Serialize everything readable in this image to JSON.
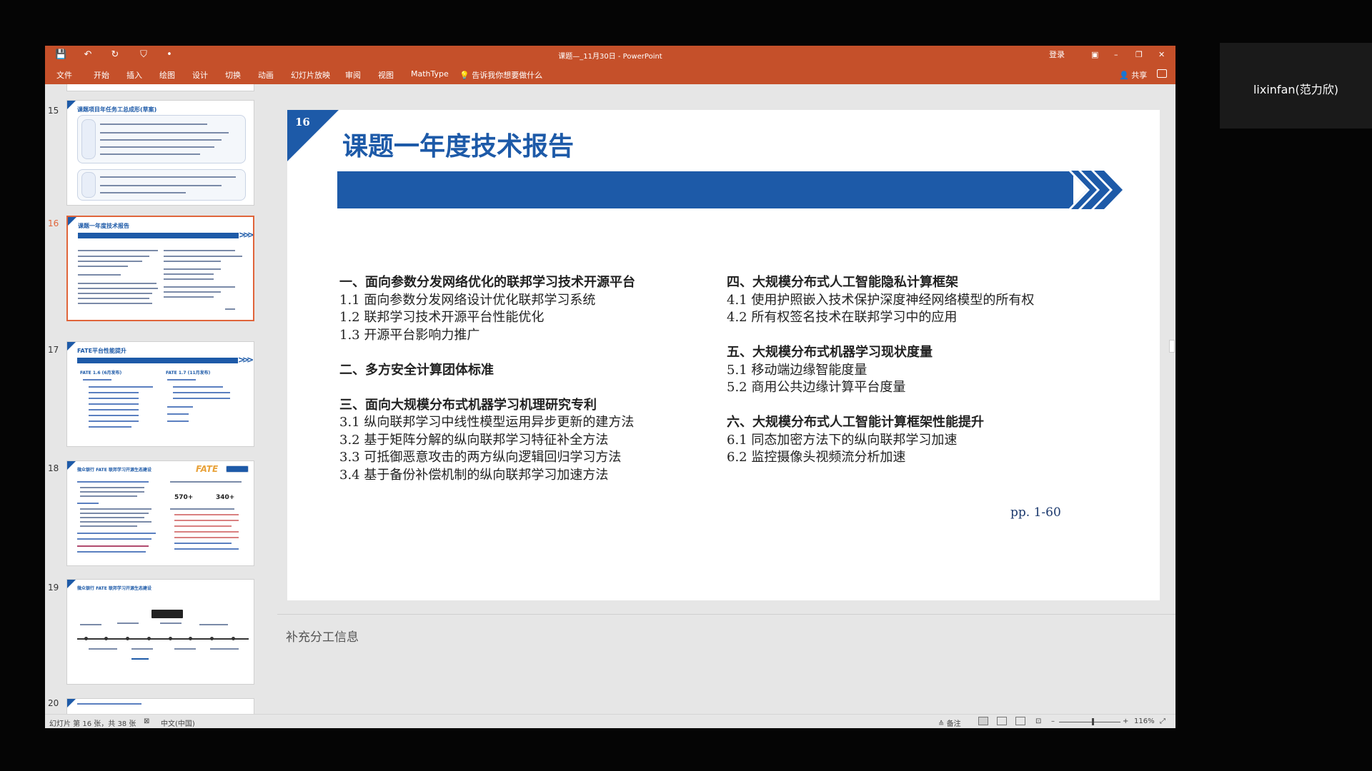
{
  "window": {
    "title": "课题—_11月30日 - PowerPoint",
    "signin": "登录",
    "quick_access": {
      "save": "💾",
      "undo": "↶",
      "redo": "↻",
      "more": "•"
    }
  },
  "ribbon": {
    "tabs": [
      "文件",
      "开始",
      "插入",
      "绘图",
      "设计",
      "切换",
      "动画",
      "幻灯片放映",
      "审阅",
      "视图",
      "MathType"
    ],
    "tell_me": "告诉我你想要做什么",
    "share": "共享"
  },
  "thumbnails": [
    {
      "number": "15",
      "title": "课题项目年任务工总成形(草案)"
    },
    {
      "number": "16",
      "title": "课题一年度技术报告"
    },
    {
      "number": "17",
      "title": "FATE平台性能提升",
      "sub_left": "FATE 1.6 (6月发布)",
      "sub_right": "FATE 1.7 (11月发布)"
    },
    {
      "number": "18",
      "title": "微众银行 FATE 联邦学习开源生态建设",
      "logo": "FATE",
      "stat1": "570+",
      "stat2": "340+"
    },
    {
      "number": "19",
      "title": "微众银行 FATE 联邦学习开源生态建设"
    },
    {
      "number": "20"
    }
  ],
  "slide": {
    "number": "16",
    "title": "课题一年度技术报告",
    "left_column": [
      {
        "text": "一、面向参数分发网络优化的联邦学习技术开源平台",
        "heading": true
      },
      {
        "text": "1.1 面向参数分发网络设计优化联邦学习系统",
        "heading": false
      },
      {
        "text": "1.2 联邦学习技术开源平台性能优化",
        "heading": false
      },
      {
        "text": "1.3 开源平台影响力推广",
        "heading": false
      },
      {
        "text": "",
        "heading": false
      },
      {
        "text": "二、多方安全计算团体标准",
        "heading": true
      },
      {
        "text": "",
        "heading": false
      },
      {
        "text": "三、面向大规模分布式机器学习机理研究专利",
        "heading": true
      },
      {
        "text": "3.1 纵向联邦学习中线性模型运用异步更新的建方法",
        "heading": false
      },
      {
        "text": "3.2 基于矩阵分解的纵向联邦学习特征补全方法",
        "heading": false
      },
      {
        "text": "3.3 可抵御恶意攻击的两方纵向逻辑回归学习方法",
        "heading": false
      },
      {
        "text": "3.4 基于备份补偿机制的纵向联邦学习加速方法",
        "heading": false
      }
    ],
    "right_column": [
      {
        "text": "四、大规模分布式人工智能隐私计算框架",
        "heading": true
      },
      {
        "text": "4.1 使用护照嵌入技术保护深度神经网络模型的所有权",
        "heading": false
      },
      {
        "text": "4.2 所有权签名技术在联邦学习中的应用",
        "heading": false
      },
      {
        "text": "",
        "heading": false
      },
      {
        "text": "五、大规模分布式机器学习现状度量",
        "heading": true
      },
      {
        "text": "5.1 移动端边缘智能度量",
        "heading": false
      },
      {
        "text": "5.2 商用公共边缘计算平台度量",
        "heading": false
      },
      {
        "text": "",
        "heading": false
      },
      {
        "text": "六、大规模分布式人工智能计算框架性能提升",
        "heading": true
      },
      {
        "text": "6.1 同态加密方法下的纵向联邦学习加速",
        "heading": false
      },
      {
        "text": "6.2 监控摄像头视频流分析加速",
        "heading": false
      }
    ],
    "pages": "pp. 1-60"
  },
  "notes": {
    "text": "补充分工信息"
  },
  "status_bar": {
    "slide_counter": "幻灯片 第 16 张，共 38 张",
    "language": "中文(中国)",
    "notes_label": "备注",
    "zoom": "116%",
    "zoom_level": 0.55
  },
  "participant": {
    "name": "lixinfan(范力欣)"
  },
  "colors": {
    "accent": "#c5502a",
    "slide_blue": "#1d5aa8",
    "selection": "#e0653b"
  }
}
